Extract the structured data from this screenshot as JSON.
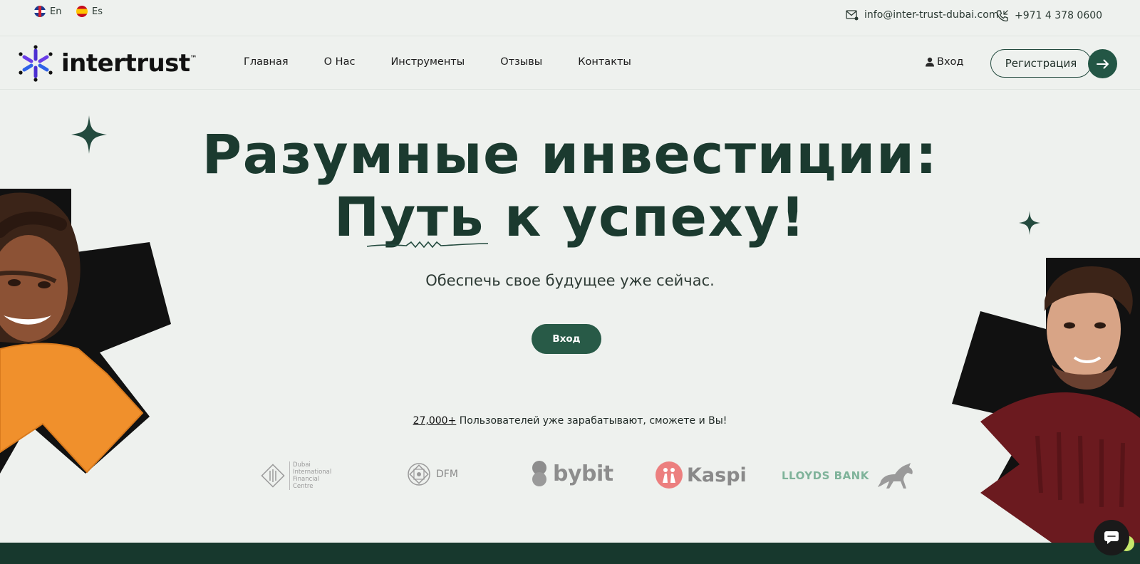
{
  "topbar": {
    "languages": [
      {
        "label": "En",
        "flag": "uk-flag"
      },
      {
        "label": "Es",
        "flag": "spain-flag"
      }
    ],
    "email": "info@inter-trust-dubai.com",
    "phone": "+971 4 378 0600"
  },
  "nav": {
    "brand": "intertrust",
    "brand_tm": "™",
    "links": [
      "Главная",
      "О Нас",
      "Инструменты",
      "Отзывы",
      "Контакты"
    ],
    "login": "Вход",
    "register": "Регистрация"
  },
  "hero": {
    "title_line1": "Разумные инвестиции:",
    "title_line2": "Путь к успеху!",
    "subtitle": "Обеспечь свое будущее уже сейчас.",
    "cta": "Вход",
    "users_count": "27,000+",
    "users_text": " Пользователей уже зарабатывают, сможете и Вы!"
  },
  "partners": {
    "difc": "Dubai International Financial Centre",
    "dfm": "DFM",
    "bybit": "bybit",
    "kaspi": "Kaspi",
    "lloyds": "LLOYDS BANK"
  },
  "colors": {
    "primary": "#285a47",
    "dark": "#1b3a2f",
    "background": "#eef1ee",
    "footer": "#17382d"
  }
}
